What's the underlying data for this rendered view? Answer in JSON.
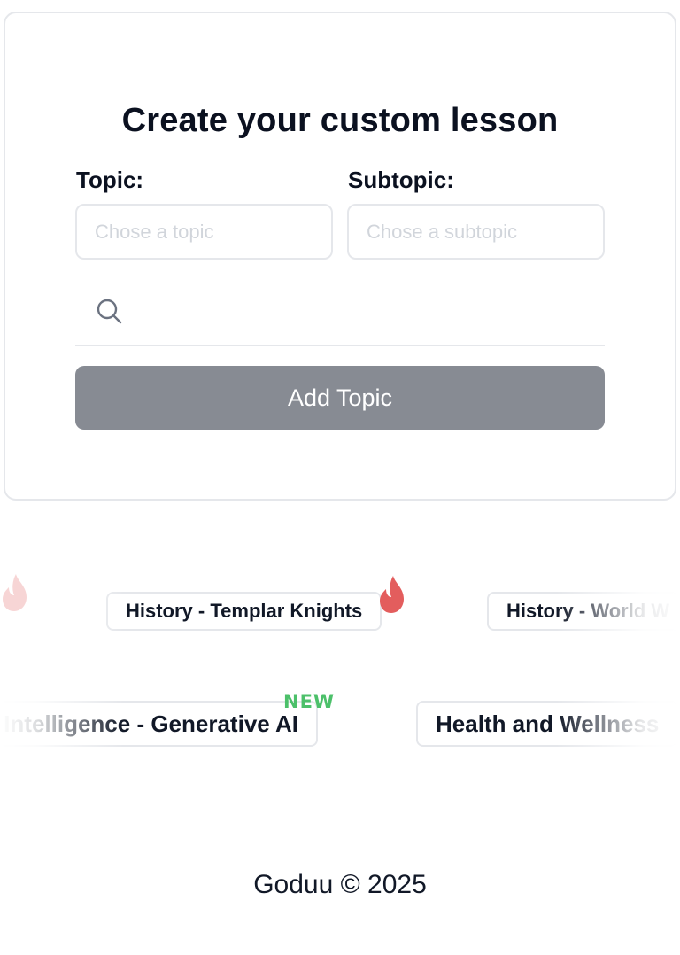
{
  "card": {
    "title": "Create your custom lesson",
    "topic_label": "Topic:",
    "subtopic_label": "Subtopic:",
    "topic_placeholder": "Chose a topic",
    "subtopic_placeholder": "Chose a subtopic",
    "search_value": "",
    "add_button_label": "Add Topic"
  },
  "colors": {
    "button_bg": "#878b93",
    "flame": "#e35d5d",
    "new_badge": "#4cc06a"
  },
  "topic_chips": {
    "row1": [
      {
        "label": "History - Templar Knights",
        "badge": "flame-icon"
      },
      {
        "label": "History - World W",
        "badge": ""
      }
    ],
    "row2": [
      {
        "label": "Artificial Intelligence - Generative AI",
        "badge": "NEW"
      },
      {
        "label": "Health and Wellness",
        "badge": ""
      }
    ]
  },
  "footer": {
    "copyright": "Goduu © 2025"
  }
}
